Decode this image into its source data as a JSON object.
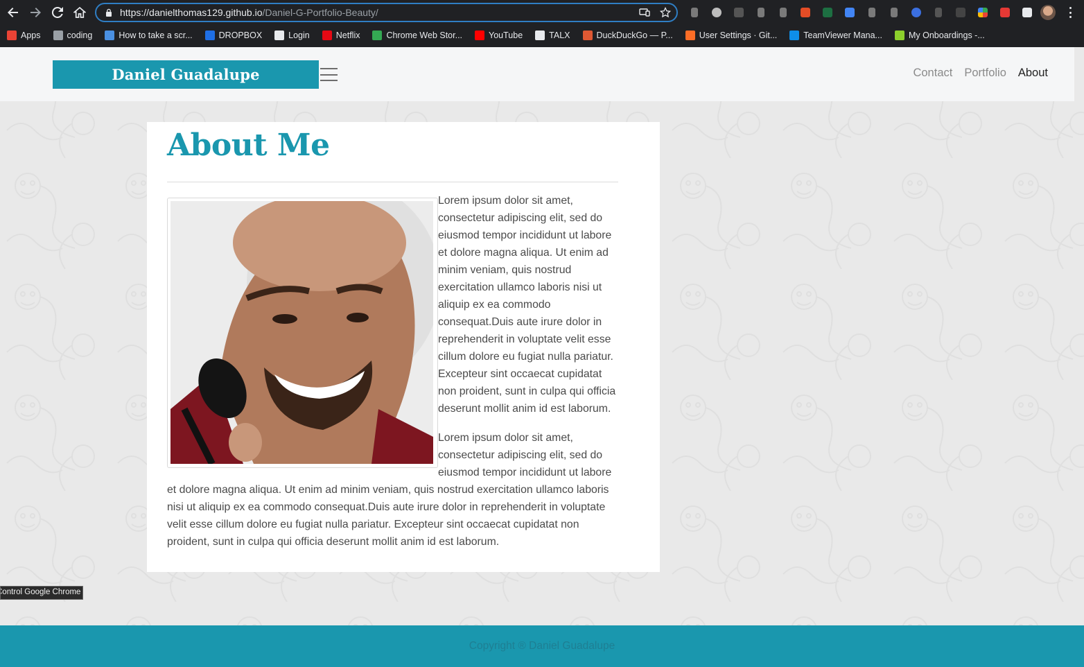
{
  "browser": {
    "url_scheme": "https://",
    "url_host": "danielthomas129.github.io",
    "url_path": "/Daniel-G-Portfolio-Beauty/",
    "bookmarks": [
      {
        "label": "Apps",
        "color": "#ea4335"
      },
      {
        "label": "coding",
        "color": "#9aa0a6"
      },
      {
        "label": "How to take a scr...",
        "color": "#4a90e2"
      },
      {
        "label": "DROPBOX",
        "color": "#1f6fe5"
      },
      {
        "label": "Login",
        "color": "#e8eaed"
      },
      {
        "label": "Netflix",
        "color": "#e50914"
      },
      {
        "label": "Chrome Web Stor...",
        "color": "#34a853"
      },
      {
        "label": "YouTube",
        "color": "#ff0000"
      },
      {
        "label": "TALX",
        "color": "#e8eaed"
      },
      {
        "label": "DuckDuckGo — P...",
        "color": "#de5833"
      },
      {
        "label": "User Settings · Git...",
        "color": "#fc6d26"
      },
      {
        "label": "TeamViewer Mana...",
        "color": "#0e8ee9"
      },
      {
        "label": "My Onboardings -...",
        "color": "#8ccf2c"
      }
    ],
    "tooltip": "Control Google Chrome"
  },
  "site": {
    "brand": "Daniel Guadalupe",
    "nav": [
      {
        "label": "Contact",
        "active": false
      },
      {
        "label": "Portfolio",
        "active": false
      },
      {
        "label": "About",
        "active": true
      }
    ],
    "accent_color": "#1a97ae"
  },
  "about": {
    "heading": "About Me",
    "paragraph_1": "Lorem ipsum dolor sit amet, consectetur adipiscing elit, sed do eiusmod tempor incididunt ut labore et dolore magna aliqua. Ut enim ad minim veniam, quis nostrud exercitation ullamco laboris nisi ut aliquip ex ea commodo consequat.Duis aute irure dolor in reprehenderit in voluptate velit esse cillum dolore eu fugiat nulla pariatur. Excepteur sint occaecat cupidatat non proident, sunt in culpa qui officia deserunt mollit anim id est laborum.",
    "paragraph_2": "Lorem ipsum dolor sit amet, consectetur adipiscing elit, sed do eiusmod tempor incididunt ut labore et dolore magna aliqua. Ut enim ad minim veniam, quis nostrud exercitation ullamco laboris nisi ut aliquip ex ea commodo consequat.Duis aute irure dolor in reprehenderit in voluptate velit esse cillum dolore eu fugiat nulla pariatur. Excepteur sint occaecat cupidatat non proident, sunt in culpa qui officia deserunt mollit anim id est laborum."
  },
  "footer": {
    "copyright": "Copyright ® Daniel Guadalupe"
  }
}
